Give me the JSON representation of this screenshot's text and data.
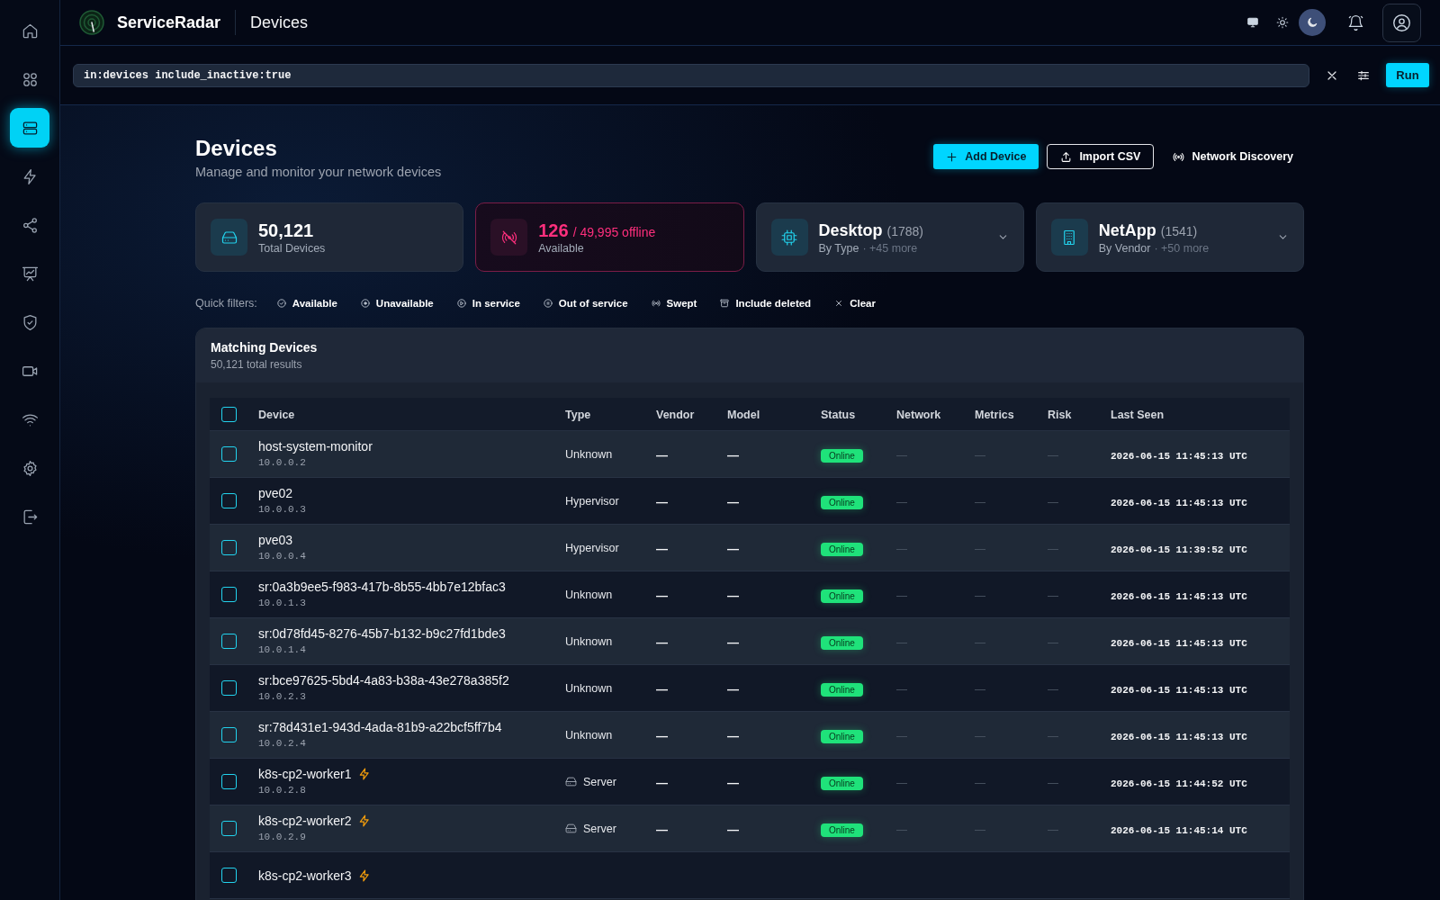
{
  "sidebar": {
    "items": [
      {
        "selected": false
      },
      {
        "selected": false
      },
      {
        "selected": true
      },
      {
        "selected": false
      },
      {
        "selected": false
      },
      {
        "selected": false
      },
      {
        "selected": false
      },
      {
        "selected": false
      },
      {
        "selected": false
      },
      {
        "selected": false
      },
      {
        "selected": false
      }
    ]
  },
  "topbar": {
    "brand": "ServiceRadar",
    "page_title": "Devices",
    "theme_options": [
      {
        "selected": false
      },
      {
        "selected": false
      },
      {
        "selected": true
      }
    ]
  },
  "query": {
    "value": "in:devices include_inactive:true",
    "run_button": "Run"
  },
  "header": {
    "title": "Devices",
    "subtitle": "Manage and monitor your network devices",
    "buttons": [
      {
        "label": "Add Device",
        "kind": "primary"
      },
      {
        "label": "Import CSV",
        "kind": "outline"
      },
      {
        "label": "Network Discovery",
        "kind": "ghost"
      }
    ]
  },
  "stat_cards": [
    {
      "kind": "total",
      "value": "50,121",
      "label": "Total Devices"
    },
    {
      "kind": "alert",
      "value": "126",
      "detail": "/ 49,995 offline",
      "label": "Available"
    },
    {
      "kind": "breakdown",
      "value": "Desktop",
      "count": "(1788)",
      "label": "By Type",
      "extra": "· +45 more"
    },
    {
      "kind": "breakdown",
      "value": "NetApp",
      "count": "(1541)",
      "label": "By Vendor",
      "extra": "· +50 more"
    }
  ],
  "quick_filters": {
    "label": "Quick filters:",
    "items": [
      {
        "label": "Available",
        "selected": false
      },
      {
        "label": "Unavailable",
        "selected": false
      },
      {
        "label": "In service",
        "selected": false
      },
      {
        "label": "Out of service",
        "selected": false
      },
      {
        "label": "Swept",
        "selected": false
      },
      {
        "label": "Include deleted",
        "selected": false
      },
      {
        "label": "Clear",
        "selected": false
      }
    ]
  },
  "table": {
    "title": "Matching Devices",
    "subtitle": "50,121 total results",
    "select_all_checked": false,
    "columns": [
      "Device",
      "Type",
      "Vendor",
      "Model",
      "Status",
      "Network",
      "Metrics",
      "Risk",
      "Last Seen"
    ],
    "rows": [
      {
        "selected": false,
        "name": "host-system-monitor",
        "bolt": false,
        "ip": "10.0.0.2",
        "type": "Unknown",
        "type_icon": false,
        "vendor": "—",
        "model": "—",
        "status": "Online",
        "network": "—",
        "metrics": "—",
        "risk": "—",
        "last_seen": "2026-06-15 11:45:13 UTC"
      },
      {
        "selected": false,
        "name": "pve02",
        "bolt": false,
        "ip": "10.0.0.3",
        "type": "Hypervisor",
        "type_icon": false,
        "vendor": "—",
        "model": "—",
        "status": "Online",
        "network": "—",
        "metrics": "—",
        "risk": "—",
        "last_seen": "2026-06-15 11:45:13 UTC"
      },
      {
        "selected": false,
        "name": "pve03",
        "bolt": false,
        "ip": "10.0.0.4",
        "type": "Hypervisor",
        "type_icon": false,
        "vendor": "—",
        "model": "—",
        "status": "Online",
        "network": "—",
        "metrics": "—",
        "risk": "—",
        "last_seen": "2026-06-15 11:39:52 UTC"
      },
      {
        "selected": false,
        "name": "sr:0a3b9ee5-f983-417b-8b55-4bb7e12bfac3",
        "bolt": false,
        "ip": "10.0.1.3",
        "type": "Unknown",
        "type_icon": false,
        "vendor": "—",
        "model": "—",
        "status": "Online",
        "network": "—",
        "metrics": "—",
        "risk": "—",
        "last_seen": "2026-06-15 11:45:13 UTC"
      },
      {
        "selected": false,
        "name": "sr:0d78fd45-8276-45b7-b132-b9c27fd1bde3",
        "bolt": false,
        "ip": "10.0.1.4",
        "type": "Unknown",
        "type_icon": false,
        "vendor": "—",
        "model": "—",
        "status": "Online",
        "network": "—",
        "metrics": "—",
        "risk": "—",
        "last_seen": "2026-06-15 11:45:13 UTC"
      },
      {
        "selected": false,
        "name": "sr:bce97625-5bd4-4a83-b38a-43e278a385f2",
        "bolt": false,
        "ip": "10.0.2.3",
        "type": "Unknown",
        "type_icon": false,
        "vendor": "—",
        "model": "—",
        "status": "Online",
        "network": "—",
        "metrics": "—",
        "risk": "—",
        "last_seen": "2026-06-15 11:45:13 UTC"
      },
      {
        "selected": false,
        "name": "sr:78d431e1-943d-4ada-81b9-a22bcf5ff7b4",
        "bolt": false,
        "ip": "10.0.2.4",
        "type": "Unknown",
        "type_icon": false,
        "vendor": "—",
        "model": "—",
        "status": "Online",
        "network": "—",
        "metrics": "—",
        "risk": "—",
        "last_seen": "2026-06-15 11:45:13 UTC"
      },
      {
        "selected": false,
        "name": "k8s-cp2-worker1",
        "bolt": true,
        "ip": "10.0.2.8",
        "type": "Server",
        "type_icon": true,
        "vendor": "—",
        "model": "—",
        "status": "Online",
        "network": "—",
        "metrics": "—",
        "risk": "—",
        "last_seen": "2026-06-15 11:44:52 UTC"
      },
      {
        "selected": false,
        "name": "k8s-cp2-worker2",
        "bolt": true,
        "ip": "10.0.2.9",
        "type": "Server",
        "type_icon": true,
        "vendor": "—",
        "model": "—",
        "status": "Online",
        "network": "—",
        "metrics": "—",
        "risk": "—",
        "last_seen": "2026-06-15 11:45:14 UTC"
      },
      {
        "selected": false,
        "name": "k8s-cp2-worker3",
        "bolt": true
      }
    ]
  }
}
